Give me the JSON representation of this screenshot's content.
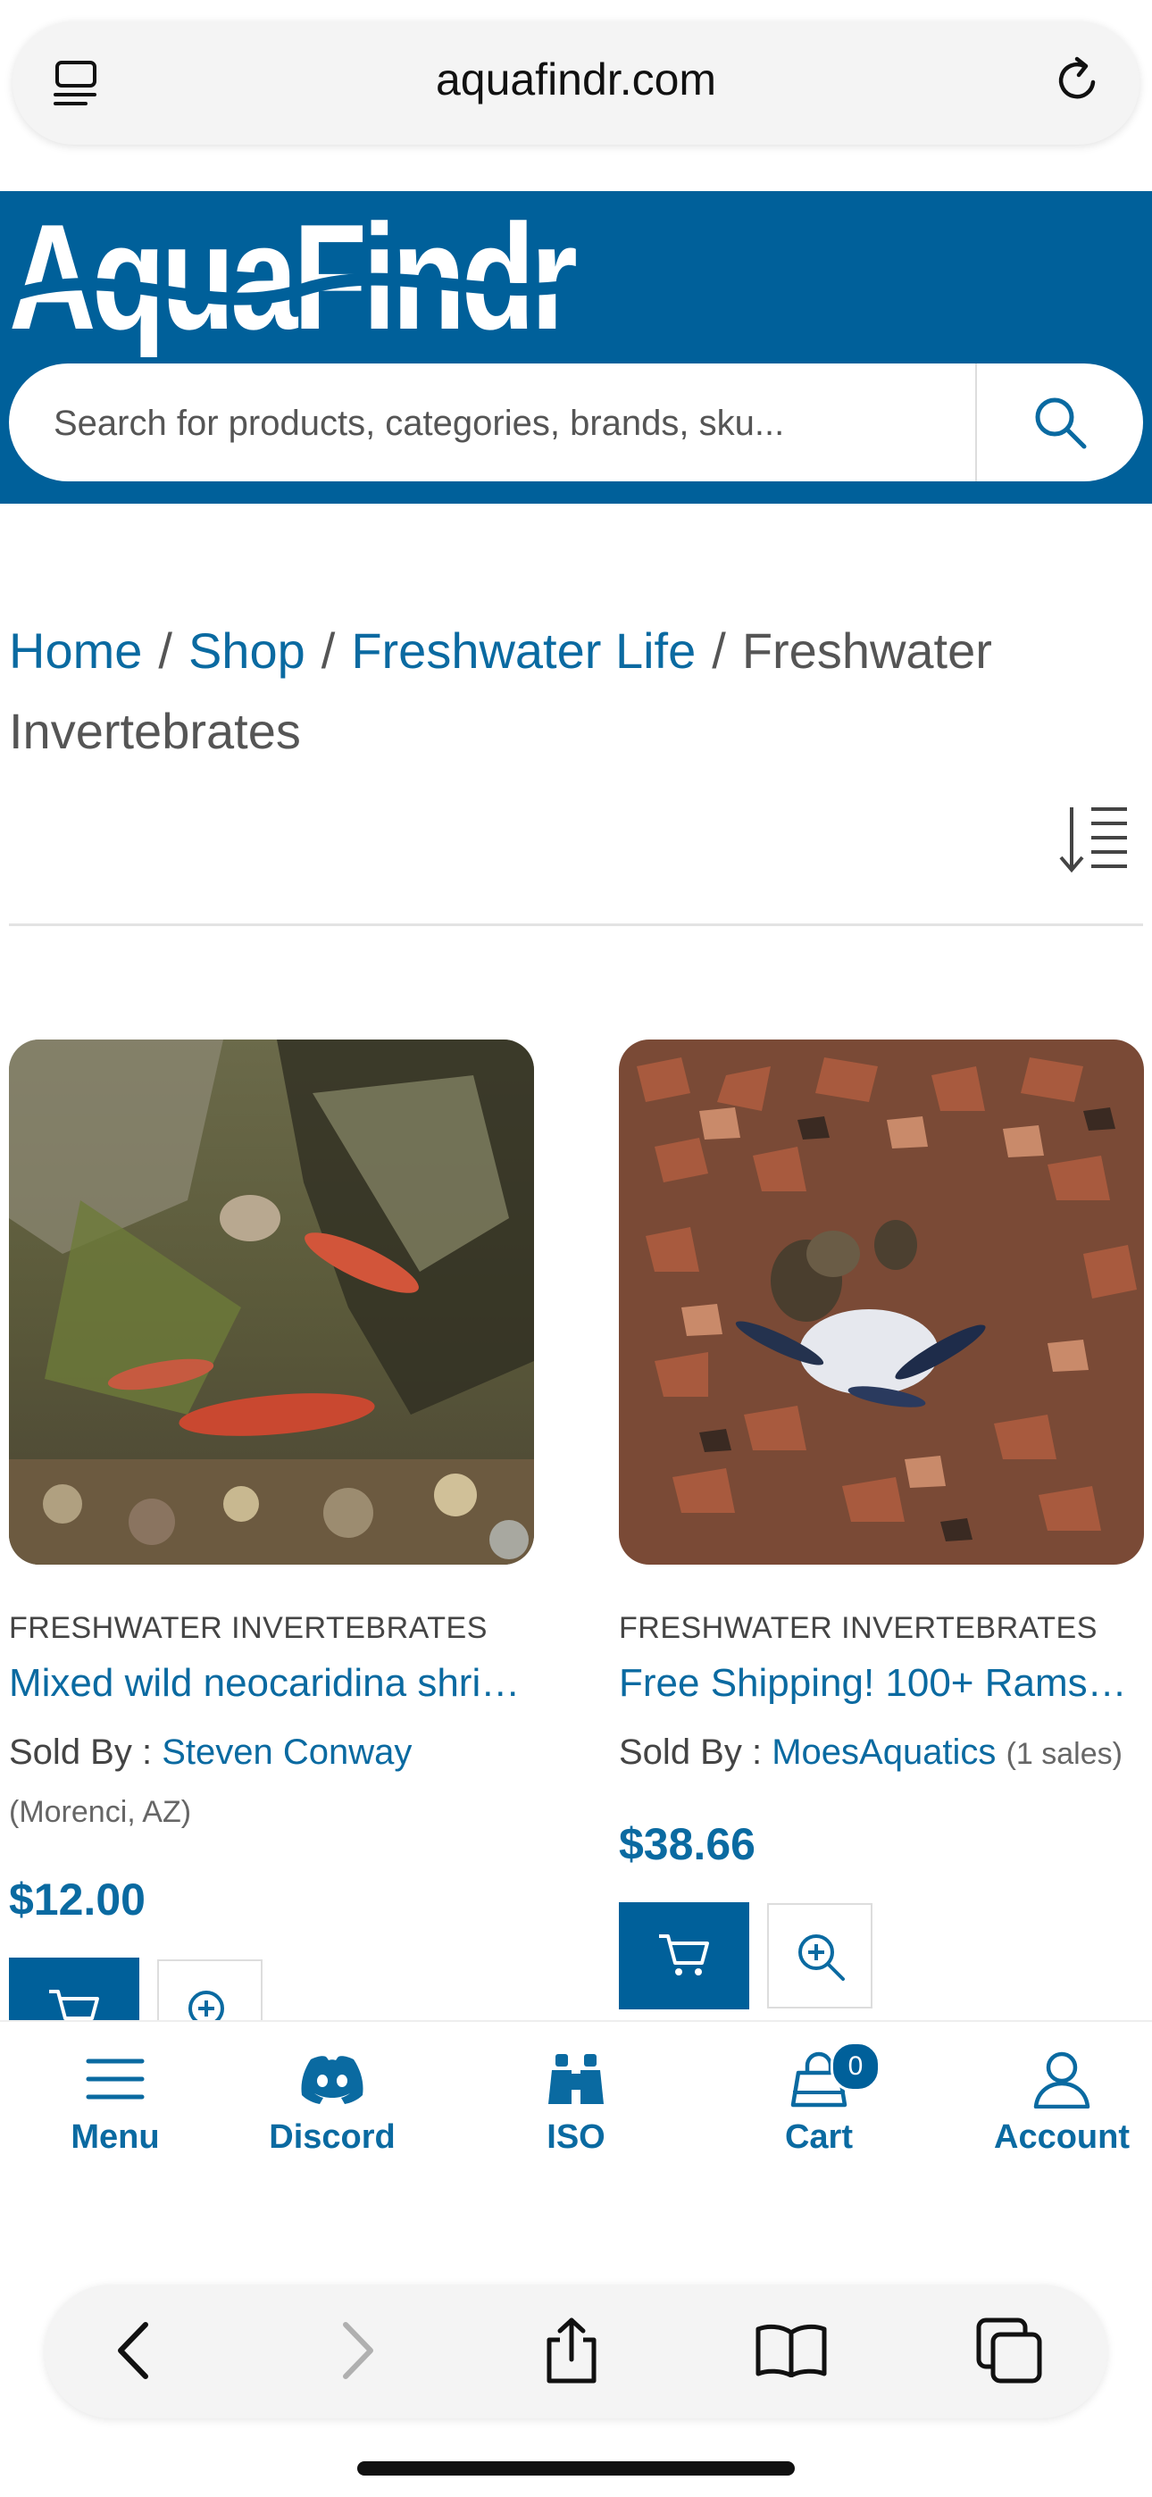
{
  "browser": {
    "url": "aquafindr.com"
  },
  "site": {
    "logo_text": "AquaFindr",
    "search": {
      "placeholder": "Search for products, categories, brands, sku..."
    }
  },
  "breadcrumb": {
    "items": [
      "Home",
      "Shop",
      "Freshwater Life"
    ],
    "current": "Freshwater Invertebrates",
    "separator": "/"
  },
  "products": [
    {
      "category": "FRESHWATER INVERTEBRATES",
      "title": "Mixed wild neocaridina shri…",
      "sold_by_label": "Sold By :",
      "seller": "Steven Conway",
      "location": "(Morenci, AZ)",
      "sales": "",
      "price": "$12.00"
    },
    {
      "category": "FRESHWATER INVERTEBRATES",
      "title": "Free Shipping! 100+ Ramsh…",
      "sold_by_label": "Sold By :",
      "seller": "MoesAquatics",
      "location": "",
      "sales": "(1 sales)",
      "price": "$38.66"
    }
  ],
  "bottom_nav": [
    {
      "label": "Menu",
      "icon": "menu-icon"
    },
    {
      "label": "Discord",
      "icon": "discord-icon"
    },
    {
      "label": "ISO",
      "icon": "binoculars-icon"
    },
    {
      "label": "Cart",
      "icon": "cart-icon",
      "badge": "0"
    },
    {
      "label": "Account",
      "icon": "account-icon"
    }
  ],
  "colors": {
    "brand_blue": "#00609a",
    "link_blue": "#0a6aa1"
  }
}
